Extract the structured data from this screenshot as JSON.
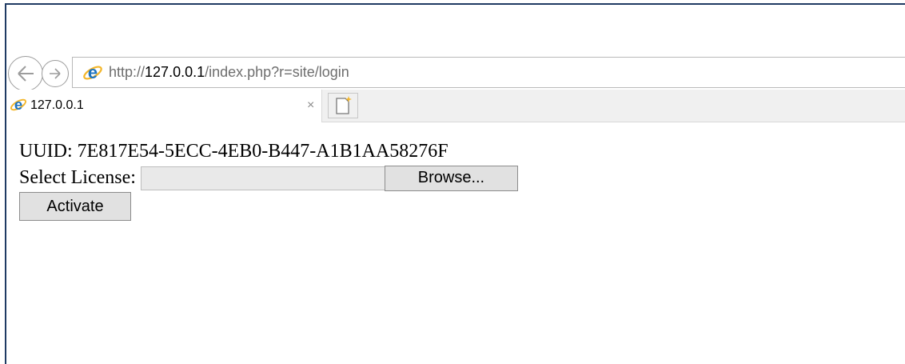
{
  "browser": {
    "url_prefix": "http://",
    "url_host": "127.0.0.1",
    "url_path": "/index.php?r=site/login",
    "tab_title": "127.0.0.1",
    "tab_close": "×",
    "icons": {
      "back": "back-arrow-icon",
      "forward": "forward-arrow-icon",
      "site": "internet-explorer-icon",
      "new_tab": "new-tab-icon"
    },
    "colors": {
      "ie_blue": "#1e73be",
      "ie_gold": "#f3b62a",
      "frame": "#1f3b63"
    }
  },
  "page": {
    "uuid_text": "UUID: 7E817E54-5ECC-4EB0-B447-A1B1AA58276F",
    "license_label": "Select License:",
    "browse_label": "Browse...",
    "activate_label": "Activate"
  }
}
